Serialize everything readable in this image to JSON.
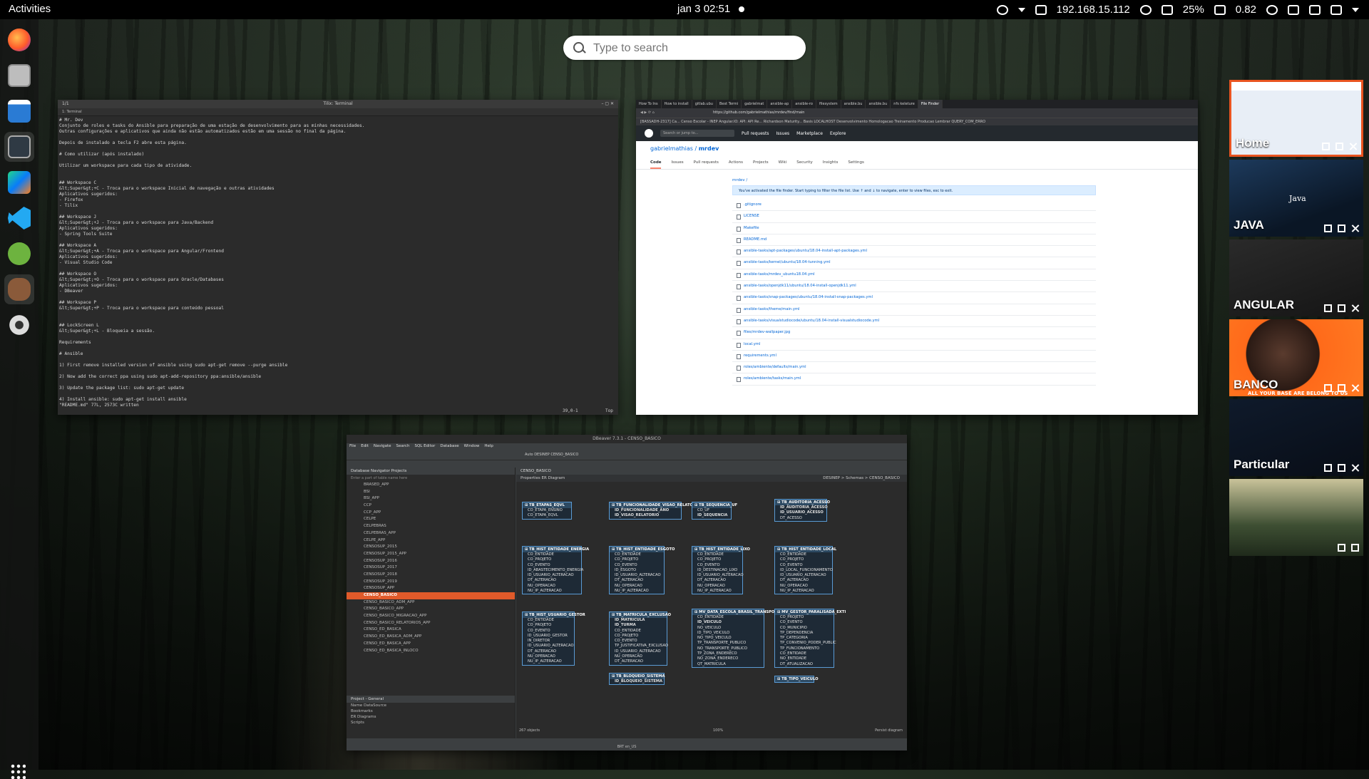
{
  "topbar": {
    "activities": "Activities",
    "clock": "jan 3  02:51",
    "ip": "192.168.15.112",
    "battery": "25%",
    "load": "0.82"
  },
  "search": {
    "placeholder": "Type to search"
  },
  "dock": {
    "items": [
      "firefox-icon",
      "files-icon",
      "writer-icon",
      "terminal-icon",
      "intellij-icon",
      "vscode-icon",
      "spring-tools-icon",
      "dbeaver-icon",
      "settings-icon"
    ]
  },
  "terminal": {
    "title": "Tilix: Terminal",
    "tab": "1: Terminal",
    "tab_counter": "1/1",
    "lines": [
      "# Mr. Dev",
      "Conjunto de roles e tasks do Ansible para preparação de uma estação de desenvolvimento para as minhas necessidades.",
      "Outras configurações e aplicativos que ainda não estão automatizados estão em uma sessão no final da página.",
      "",
      "Depois de instalado a tecla F2 abre esta página.",
      "",
      "# Como utilizar (após instalado)",
      "",
      "Utilizar um workspace para cada tipo de atividade.",
      "",
      "",
      "## Workspace C",
      "&lt;Super&gt;+C - Troca para o workspace Inicial de navegação e outras atividades",
      "Aplicativos sugeridos:",
      "- Firefox",
      "- Tilix",
      "",
      "## Workspace J",
      "&lt;Super&gt;+J - Troca para o workspace para Java/Backend",
      "Aplicativos sugeridos:",
      "- Spring Tools Suite",
      "",
      "## Workspace A",
      "&lt;Super&gt;+A - Troca para o workspace para Angular/Frontend",
      "Aplicativos sugeridos:",
      "- Visual Studio Code",
      "",
      "## Workspace O",
      "&lt;Super&gt;+O - Troca para o workspace para Oracle/Databases",
      "Aplicativos sugeridos:",
      "- DBeaver",
      "",
      "## Workspace P",
      "&lt;Super&gt;+P - Troca para o workspace para conteúdo pessoal",
      "",
      "",
      "## LockScreen L",
      "&lt;Super&gt;+L - Bloqueia a sessão.",
      "",
      "Requirements",
      "",
      "# Ansible",
      "",
      "1) First remove installed version of ansible using sudo apt-get remove --purge ansible",
      "",
      "2) Now add the correct ppa using sudo apt-add-repository ppa:ansible/ansible",
      "",
      "3) Update the package list: sudo apt-get update",
      "",
      "4) Install ansible: sudo apt-get install ansible",
      "\"README.md\" 77L, 2573C written"
    ],
    "cursor_pos": "39,0-1",
    "scroll": "Top"
  },
  "browser": {
    "tabs": [
      "How To Ins",
      "How to install",
      "gitlab.ubu",
      "Best Termi",
      "gabrielmat",
      "ansible-ap",
      "ansible-ro",
      "filesystem",
      "ansible.bu",
      "ansible.bu",
      "nfs keleture",
      "File Finder"
    ],
    "url": "https://github.com/gabrielmathias/mrdev/find/main",
    "bookmarks": "[BASSADH-2317] Ca...   Censo Escolar - INEP   Angular.IO: API: API Re...   Richardson Maturity...   Basis   LOCALHOST   Desenvolvimento   Homologacao   Treinamento   Producao   Lembrar   QUERY_COM_ERRO",
    "gh_search": "Search or jump to...",
    "gh_nav": [
      "Pull requests",
      "Issues",
      "Marketplace",
      "Explore"
    ],
    "owner": "gabrielmathias",
    "repo": "mrdev",
    "repo_tabs": [
      "Code",
      "Issues",
      "Pull requests",
      "Actions",
      "Projects",
      "Wiki",
      "Security",
      "Insights",
      "Settings"
    ],
    "path": "mrdev /",
    "flash": "You've activated the file finder. Start typing to filter the file list. Use  ↑  and  ↓  to navigate,  enter  to view files,  esc  to exit.",
    "files": [
      ".gitignore",
      "LICENSE",
      "Makefile",
      "README.md",
      "ansible-tasks/apt-packages/ubuntu/18.04-install-apt-packages.yml",
      "ansible-tasks/kernel/ubuntu/18.04-tunning.yml",
      "ansible-tasks/mrdev_ubuntu18.04.yml",
      "ansible-tasks/openjdk11/ubuntu/18.04-install-openjdk11.yml",
      "ansible-tasks/snap-packages/ubuntu/18.04-install-snap-packages.yml",
      "ansible-tasks/theme/main.yml",
      "ansible-tasks/visualstudiocode/ubuntu/18.04-install-visualstudiocode.yml",
      "files/mrdev-wallpaper.jpg",
      "local.yml",
      "requirements.yml",
      "roles/ambiente/defaults/main.yml",
      "roles/ambiente/tasks/main.yml"
    ]
  },
  "dbeaver": {
    "title": "DBeaver 7.3.1 - CENSO_BASICO",
    "menu": [
      "File",
      "Edit",
      "Navigate",
      "Search",
      "SQL Editor",
      "Database",
      "Window",
      "Help"
    ],
    "toolbar": "Auto   DESINEP   CENSO_BASICO",
    "nav_tabs": "Database Navigator   Projects",
    "filter": "Enter a part of table name here",
    "schemas": [
      "BRASED_APP",
      "BSI",
      "BSI_APP",
      "CCP",
      "CCP_APP",
      "CELPE",
      "CELPEBRAS",
      "CELPEBRAS_APP",
      "CELPE_APP",
      "CENSOSUP_2015",
      "CENSOSUP_2015_APP",
      "CENSOSUP_2016",
      "CENSOSUP_2017",
      "CENSOSUP_2018",
      "CENSOSUP_2019",
      "CENSOSUP_APP",
      "CENSO_BASICO",
      "CENSO_BASICO_ADM_APP",
      "CENSO_BASICO_APP",
      "CENSO_BASICO_MIGRACAO_APP",
      "CENSO_BASICO_RELATORIOS_APP",
      "CENSO_ED_BASICA",
      "CENSO_ED_BASICA_ADM_APP",
      "CENSO_ED_BASICA_APP",
      "CENSO_ED_BASICA_INLOCO"
    ],
    "selected_schema": "CENSO_BASICO",
    "project_title": "Project - General",
    "project_cols": "Name                                    DataSource",
    "project_items": [
      "Bookmarks",
      "ER Diagrams",
      "Scripts"
    ],
    "editor_tab": "CENSO_BASICO",
    "editor_subtabs": "Properties   ER Diagram",
    "editor_path": "DESINEP  >  Schemas  >  CENSO_BASICO",
    "object_count": "267 objects",
    "zoom": "100%",
    "status": "BRT   en_US",
    "persist": "Persist diagram",
    "tables": [
      {
        "name": "TB_ETAPAS_EQVL",
        "cols": [
          "CO_ETAPA_ENSINO",
          "CO_ETAPA_EQVL"
        ]
      },
      {
        "name": "TB_FUNCIONALIDADE_VISAO_RELATORIO",
        "cols": [
          "ID_FUNCIONALIDADE_ANO",
          "ID_VISAO_RELATORIO"
        ]
      },
      {
        "name": "TB_SEQUENCIA_UF",
        "cols": [
          "CO_UF",
          "ID_SEQUENCIA"
        ]
      },
      {
        "name": "TB_AUDITORIA_ACESSO",
        "cols": [
          "ID_AUDITORIA_ACESSO",
          "ID_USUARIO_ACESSO",
          "DT_ACESSO"
        ]
      },
      {
        "name": "TB_HIST_ENTIDADE_ENERGIA",
        "cols": [
          "CO_ENTIDADE",
          "CO_PROJETO",
          "CO_EVENTO",
          "ID_ABASTECIMENTO_ENERGIA",
          "ID_USUARIO_ALTERACAO",
          "DT_ALTERACAO",
          "NU_OPERACAO",
          "NU_IP_ALTERACAO"
        ]
      },
      {
        "name": "TB_HIST_ENTIDADE_ESGOTO",
        "cols": [
          "CO_ENTIDADE",
          "CO_PROJETO",
          "CO_EVENTO",
          "ID_ESGOTO",
          "ID_USUARIO_ALTERACAO",
          "DT_ALTERACAO",
          "NU_OPERACAO",
          "NU_IP_ALTERACAO"
        ]
      },
      {
        "name": "TB_HIST_ENTIDADE_LIXO",
        "cols": [
          "CO_ENTIDADE",
          "CO_PROJETO",
          "CO_EVENTO",
          "ID_DESTINACAO_LIXO",
          "ID_USUARIO_ALTERACAO",
          "DT_ALTERACAO",
          "NU_OPERACAO",
          "NU_IP_ALTERACAO"
        ]
      },
      {
        "name": "TB_HIST_ENTIDADE_LOCAL",
        "cols": [
          "CO_ENTIDADE",
          "CO_PROJETO",
          "CO_EVENTO",
          "ID_LOCAL_FUNCIONAMENTO",
          "ID_USUARIO_ALTERACAO",
          "DT_ALTERACAO",
          "NU_OPERACAO",
          "NU_IP_ALTERACAO"
        ]
      },
      {
        "name": "TB_HIST_USUARIO_GESTOR",
        "cols": [
          "CO_ENTIDADE",
          "CO_PROJETO",
          "CO_EVENTO",
          "ID_USUARIO_GESTOR",
          "IN_DIRETOR",
          "ID_USUARIO_ALTERACAO",
          "DT_ALTERACAO",
          "NU_OPERACAO",
          "NU_IP_ALTERACAO"
        ]
      },
      {
        "name": "TB_MATRICULA_EXCLUSAO",
        "cols": [
          "ID_MATRICULA",
          "ID_TURMA",
          "CO_ENTIDADE",
          "CO_PROJETO",
          "CO_EVENTO",
          "TP_JUSTIFICATIVA_EXCLUSAO",
          "ID_USUARIO_ALTERACAO",
          "NU_OPERACAO",
          "DT_ALTERACAO"
        ]
      },
      {
        "name": "MV_DATA_ESCOLA_BRASIL_TRANSPOR",
        "cols": [
          "CO_ENTIDADE",
          "ID_VEICULO",
          "NO_VEICULO",
          "ID_TIPO_VEICULO",
          "NO_TIPO_VEICULO",
          "TP_TRANSPORTE_PUBLICO",
          "NO_TRANSPORTE_PUBLICO",
          "TP_ZONA_ENDERECO",
          "NO_ZONA_ENDERECO",
          "QT_MATRICULA"
        ]
      },
      {
        "name": "MV_GESTOR_PARALISADA_EXTI",
        "cols": [
          "CO_PROJETO",
          "CO_EVENTO",
          "CO_MUNICIPIO",
          "TP_DEPENDENCIA",
          "TP_CATEGORIA",
          "TP_CONVENIO_PODER_PUBLIC",
          "TP_FUNCIONAMENTO",
          "CO_ENTIDADE",
          "NO_ENTIDADE",
          "DT_ATUALIZACAO"
        ]
      },
      {
        "name": "TB_BLOQUEIO_SISTEMA",
        "cols": [
          "ID_BLOQUEIO_SISTEMA"
        ]
      },
      {
        "name": "TB_TIPO_VEICULO",
        "cols": []
      }
    ]
  },
  "workspaces": [
    {
      "label": "Home",
      "current": true
    },
    {
      "label": "JAVA",
      "current": false
    },
    {
      "label": "ANGULAR",
      "current": false
    },
    {
      "label": "BANCO",
      "current": false,
      "caption": "ALL YOUR BASE ARE BELONG TO US"
    },
    {
      "label": "Particular",
      "current": false
    },
    {
      "label": "",
      "current": false
    }
  ],
  "java_logo_text": "Java",
  "colors": {
    "accent": "#e95420",
    "selection": "#e05a2a",
    "topbar": "#000000"
  }
}
